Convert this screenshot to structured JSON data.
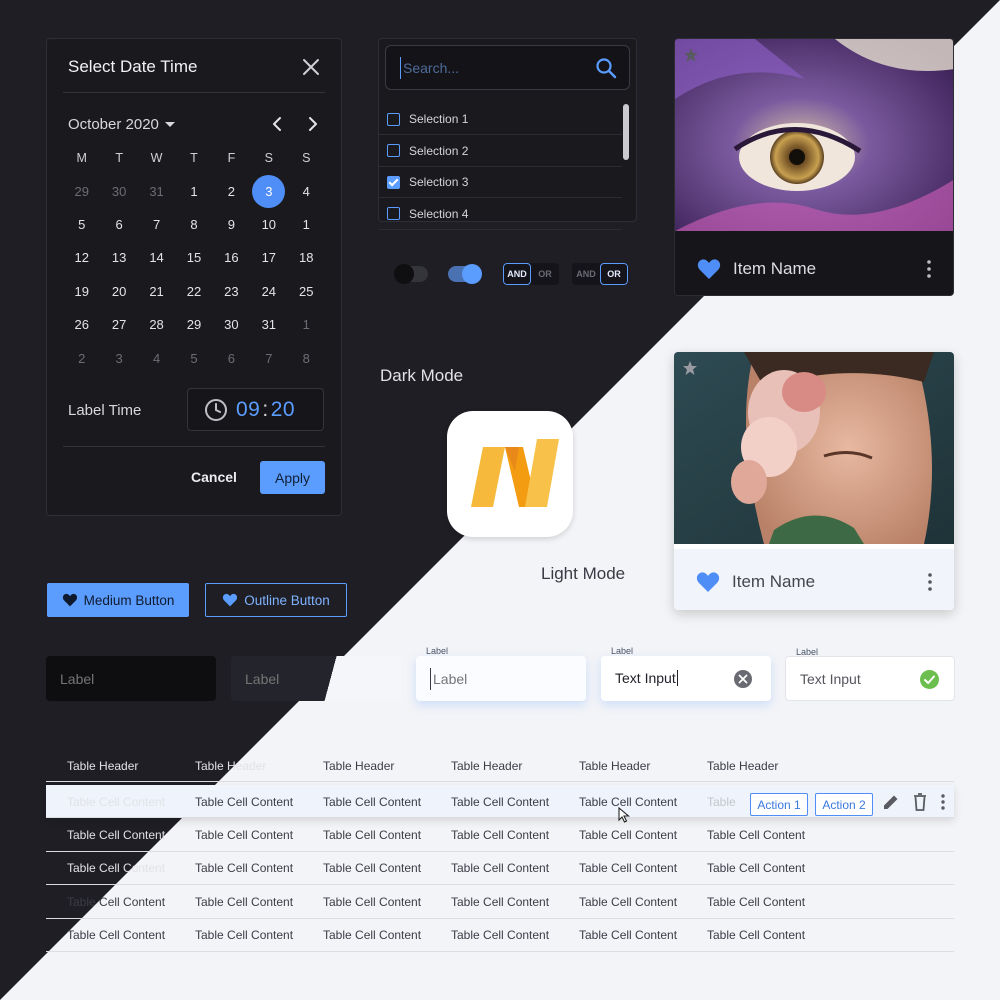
{
  "theme": {
    "accent": "#5b9cff",
    "dark_bg": "#1e1e24",
    "light_bg": "#f3f4f7",
    "success": "#6cbf4f"
  },
  "picker": {
    "title": "Select Date Time",
    "month": "October 2020",
    "weekdays": [
      "M",
      "T",
      "W",
      "T",
      "F",
      "S",
      "S"
    ],
    "days": [
      {
        "d": "29",
        "m": true
      },
      {
        "d": "30",
        "m": true
      },
      {
        "d": "31",
        "m": true
      },
      {
        "d": "1"
      },
      {
        "d": "2"
      },
      {
        "d": "3",
        "sel": true
      },
      {
        "d": "4"
      },
      {
        "d": "5"
      },
      {
        "d": "6"
      },
      {
        "d": "7"
      },
      {
        "d": "8"
      },
      {
        "d": "9"
      },
      {
        "d": "10"
      },
      {
        "d": "1"
      },
      {
        "d": "12"
      },
      {
        "d": "13"
      },
      {
        "d": "14"
      },
      {
        "d": "15"
      },
      {
        "d": "16"
      },
      {
        "d": "17"
      },
      {
        "d": "18"
      },
      {
        "d": "19"
      },
      {
        "d": "20"
      },
      {
        "d": "21"
      },
      {
        "d": "22"
      },
      {
        "d": "23"
      },
      {
        "d": "24"
      },
      {
        "d": "25"
      },
      {
        "d": "26"
      },
      {
        "d": "27"
      },
      {
        "d": "28"
      },
      {
        "d": "29"
      },
      {
        "d": "30"
      },
      {
        "d": "31"
      },
      {
        "d": "1",
        "m": true
      },
      {
        "d": "2",
        "m": true
      },
      {
        "d": "3",
        "m": true
      },
      {
        "d": "4",
        "m": true
      },
      {
        "d": "5",
        "m": true
      },
      {
        "d": "6",
        "m": true
      },
      {
        "d": "7",
        "m": true
      },
      {
        "d": "8",
        "m": true
      }
    ],
    "time_label": "Label Time",
    "hours": "09",
    "minutes": "20",
    "cancel": "Cancel",
    "apply": "Apply"
  },
  "search": {
    "placeholder": "Search...",
    "options": [
      {
        "label": "Selection 1",
        "checked": false
      },
      {
        "label": "Selection 2",
        "checked": false
      },
      {
        "label": "Selection 3",
        "checked": true
      },
      {
        "label": "Selection 4",
        "checked": false
      }
    ]
  },
  "toggles": {
    "off": false,
    "on": true,
    "seg1": {
      "and": "AND",
      "or": "OR",
      "active": "AND"
    },
    "seg2": {
      "and": "AND",
      "or": "OR",
      "active": "OR"
    }
  },
  "modes": {
    "dark": "Dark Mode",
    "light": "Light Mode"
  },
  "cards": [
    {
      "name": "Item Name",
      "icon": "heart-icon"
    },
    {
      "name": "Item Name",
      "icon": "heart-icon"
    }
  ],
  "buttons": {
    "medium": "Medium Button",
    "outline": "Outline Button"
  },
  "inputs": [
    {
      "placeholder": "Label",
      "value": ""
    },
    {
      "placeholder": "Label",
      "value": ""
    },
    {
      "label": "Label",
      "placeholder": "Label",
      "value": ""
    },
    {
      "label": "Label",
      "value": "Text Input"
    },
    {
      "label": "Label",
      "value": "Text Input"
    }
  ],
  "table": {
    "headers": [
      "Table Header",
      "Table Header",
      "Table Header",
      "Table Header",
      "Table Header",
      "Table Header"
    ],
    "rows": [
      [
        "Table Cell Content",
        "Table Cell Content",
        "Table Cell Content",
        "Table Cell Content",
        "Table Cell Content",
        "Table"
      ],
      [
        "Table Cell Content",
        "Table Cell Content",
        "Table Cell Content",
        "Table Cell Content",
        "Table Cell Content",
        "Table Cell Content"
      ],
      [
        "Table Cell Content",
        "Table Cell Content",
        "Table Cell Content",
        "Table Cell Content",
        "Table Cell Content",
        "Table Cell Content"
      ],
      [
        "Table Cell Content",
        "Table Cell Content",
        "Table Cell Content",
        "Table Cell Content",
        "Table Cell Content",
        "Table Cell Content"
      ],
      [
        "Table Cell Content",
        "Table Cell Content",
        "Table Cell Content",
        "Table Cell Content",
        "Table Cell Content",
        "Table Cell Content"
      ]
    ],
    "actions": [
      "Action 1",
      "Action 2"
    ]
  }
}
